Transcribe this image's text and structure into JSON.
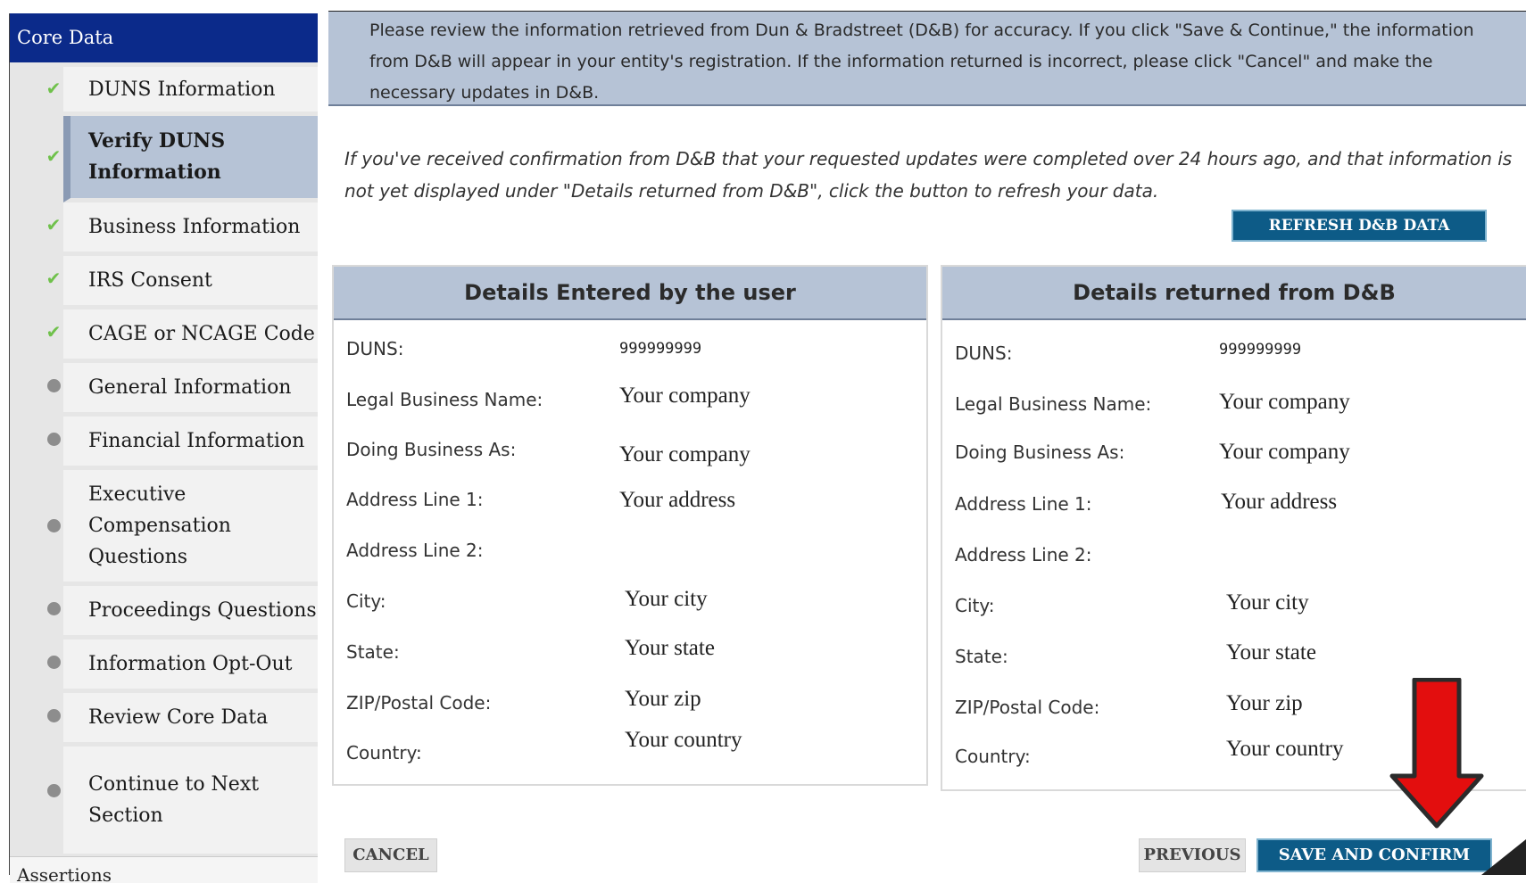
{
  "sidebar": {
    "header": "Core Data",
    "items": [
      {
        "label": "DUNS Information",
        "status": "check"
      },
      {
        "label": "Verify DUNS Information",
        "status": "check"
      },
      {
        "label": "Business Information",
        "status": "check"
      },
      {
        "label": "IRS Consent",
        "status": "check"
      },
      {
        "label": "CAGE or NCAGE Code",
        "status": "check"
      },
      {
        "label": "General Information",
        "status": "dot"
      },
      {
        "label": "Financial Information",
        "status": "dot"
      },
      {
        "label": "Executive Compensation Questions",
        "status": "dot"
      },
      {
        "label": "Proceedings Questions",
        "status": "dot"
      },
      {
        "label": "Information Opt-Out",
        "status": "dot"
      },
      {
        "label": "Review Core Data",
        "status": "dot"
      },
      {
        "label": "Continue to Next Section",
        "status": "dot"
      }
    ],
    "footer": "Assertions"
  },
  "banner": {
    "text": "Please review the information retrieved from Dun & Bradstreet (D&B) for accuracy. If you click \"Save & Continue,\" the information from D&B will appear in your entity's registration. If the information returned is incorrect, please click \"Cancel\" and make the necessary updates in D&B."
  },
  "refresh": {
    "note": "If you've received confirmation from D&B that your requested updates were completed over 24 hours ago, and that information is not yet displayed under \"Details returned from D&B\", click the button to refresh your data.",
    "button": "REFRESH D&B DATA"
  },
  "labels": {
    "duns": "DUNS:",
    "legal_name": "Legal Business Name:",
    "dba": "Doing Business As:",
    "addr1": "Address Line 1:",
    "addr2": "Address Line 2:",
    "city": "City:",
    "state": "State:",
    "zip": "ZIP/Postal Code:",
    "country": "Country:"
  },
  "user_panel": {
    "title": "Details Entered by the user",
    "duns": "999999999",
    "legal_name": "Your company",
    "dba": "Your company",
    "addr1": "Your address",
    "addr2": "",
    "city": "Your city",
    "state": "Your state",
    "zip": "Your zip",
    "country": "Your country"
  },
  "dnb_panel": {
    "title": "Details returned from D&B",
    "duns": "999999999",
    "legal_name": "Your company",
    "dba": "Your company",
    "addr1": "Your address",
    "addr2": "",
    "city": "Your city",
    "state": "Your state",
    "zip": "Your zip",
    "country": "Your country"
  },
  "buttons": {
    "cancel": "CANCEL",
    "previous": "PREVIOUS",
    "save": "SAVE AND CONFIRM"
  },
  "colors": {
    "sidebar_header": "#0b2a8a",
    "highlight": "#b6c3d6",
    "button_blue": "#0d5b87",
    "check_green": "#6fc14b",
    "arrow_red": "#e30e0e"
  }
}
